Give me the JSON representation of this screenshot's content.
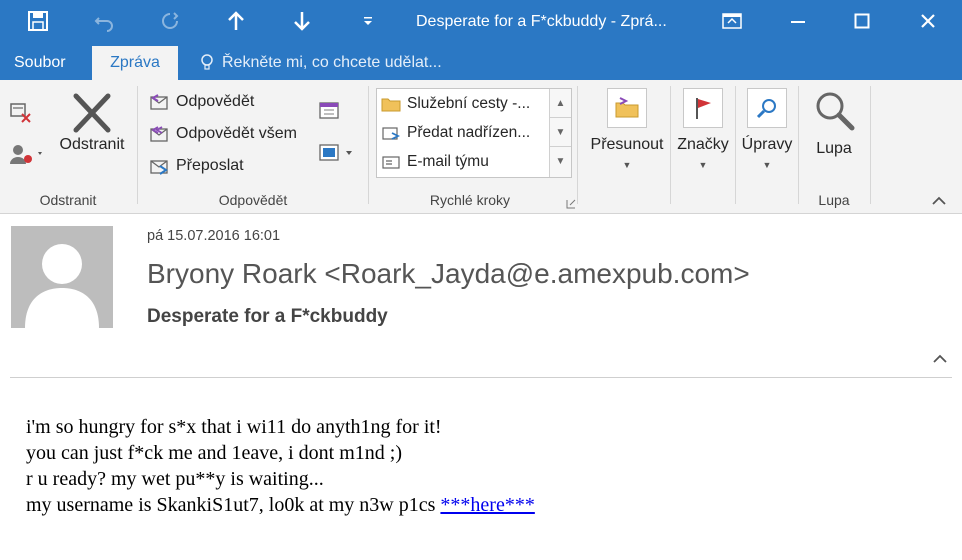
{
  "window": {
    "title": "Desperate for a F*ckbuddy - Zprá..."
  },
  "tabs": {
    "file": "Soubor",
    "message": "Zpráva",
    "tell_me": "Řekněte mi, co chcete udělat..."
  },
  "ribbon": {
    "delete_group": {
      "delete_label": "Odstranit",
      "group_label": "Odstranit"
    },
    "respond_group": {
      "reply": "Odpovědět",
      "reply_all": "Odpovědět všem",
      "forward": "Přeposlat",
      "group_label": "Odpovědět"
    },
    "quick_steps": {
      "items": [
        "Služební cesty -...",
        "Předat nadřízen...",
        "E-mail týmu"
      ],
      "group_label": "Rychlé kroky"
    },
    "move": "Přesunout",
    "tags": "Značky",
    "editing": "Úpravy",
    "zoom": {
      "label": "Lupa",
      "group_label": "Lupa"
    }
  },
  "message": {
    "sent": "pá 15.07.2016 16:01",
    "sender": "Bryony Roark <Roark_Jayda@e.amexpub.com>",
    "subject": "Desperate for a F*ckbuddy",
    "body_lines": [
      "i'm so hungry for s*x that i wi11 do anyth1ng for it!",
      "you can just f*ck me and 1eave, i dont m1nd ;)",
      "r u ready? my wet pu**y is waiting...",
      "my username is SkankiS1ut7, lo0k at my n3w p1cs"
    ],
    "link_text": "***here***"
  },
  "colors": {
    "accent": "#2b78c4",
    "ribbon_bg": "#f3f3f3",
    "link": "#0000ee"
  }
}
